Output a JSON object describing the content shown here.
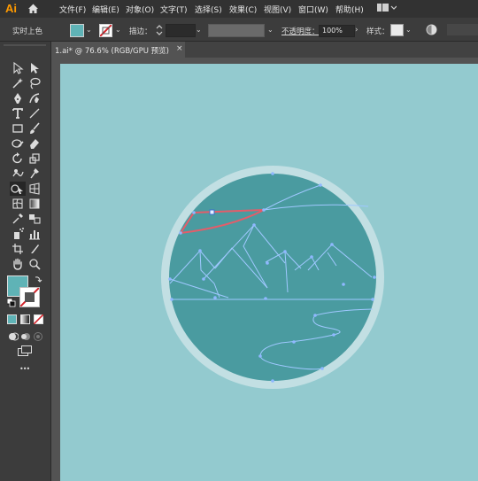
{
  "app": {
    "logo_text": "Ai",
    "brand_color": "#ff9a00"
  },
  "menubar": {
    "items": [
      {
        "label": "文件(F)"
      },
      {
        "label": "编辑(E)"
      },
      {
        "label": "对象(O)"
      },
      {
        "label": "文字(T)"
      },
      {
        "label": "选择(S)"
      },
      {
        "label": "效果(C)"
      },
      {
        "label": "视图(V)"
      },
      {
        "label": "窗口(W)"
      },
      {
        "label": "帮助(H)"
      }
    ]
  },
  "control_bar": {
    "live_paint_label": "实时上色",
    "stroke_label": "描边：",
    "opacity_label": "不透明度：",
    "opacity_value": "100%",
    "style_label": "样式：",
    "fill_color": "#5fb3b6"
  },
  "document_tab": {
    "label": "1.ai* @ 76.6% (RGB/GPU 预览)",
    "close_glyph": "×"
  },
  "toolbar": {
    "more_label": "•••"
  },
  "canvas": {
    "background": "#93cacf",
    "outer_ring_color": "#c2dfe3",
    "circle_fill": "#4a9ba0",
    "path_color": "#9fc8ff",
    "selected_color": "#e35d6a"
  }
}
